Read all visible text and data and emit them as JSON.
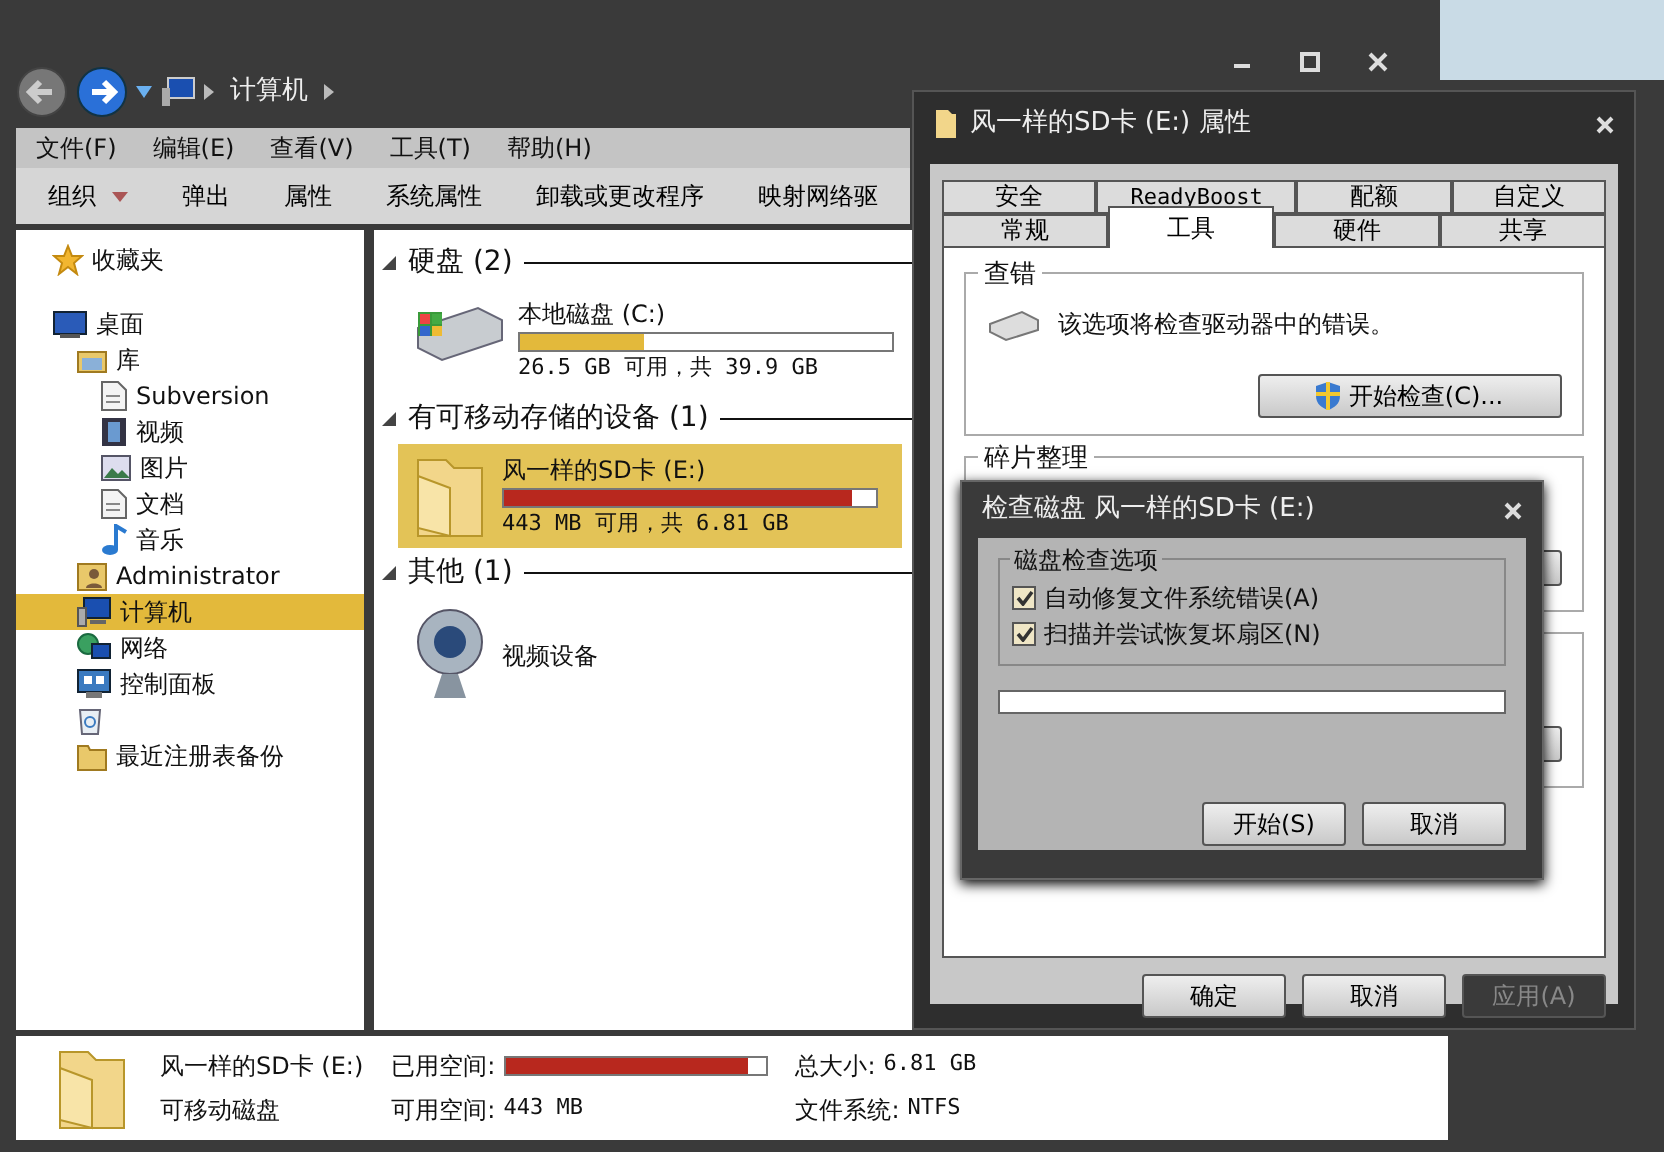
{
  "explorer": {
    "breadcrumb": [
      "计算机"
    ],
    "menu": [
      "文件(F)",
      "编辑(E)",
      "查看(V)",
      "工具(T)",
      "帮助(H)"
    ],
    "toolbar": [
      {
        "label": "组织",
        "dropdown": true
      },
      {
        "label": "弹出",
        "dropdown": false
      },
      {
        "label": "属性",
        "dropdown": false
      },
      {
        "label": "系统属性",
        "dropdown": false
      },
      {
        "label": "卸载或更改程序",
        "dropdown": false
      },
      {
        "label": "映射网络驱",
        "dropdown": false
      }
    ],
    "sidebar": {
      "items": [
        {
          "label": "收藏夹",
          "kind": "star",
          "selected": false
        },
        {
          "label": "桌面",
          "kind": "desktop",
          "selected": false,
          "children": [
            {
              "label": "库",
              "kind": "library",
              "selected": false,
              "children": [
                {
                  "label": "Subversion",
                  "kind": "doc",
                  "selected": false
                },
                {
                  "label": "视频",
                  "kind": "video",
                  "selected": false
                },
                {
                  "label": "图片",
                  "kind": "picture",
                  "selected": false
                },
                {
                  "label": "文档",
                  "kind": "doc",
                  "selected": false
                },
                {
                  "label": "音乐",
                  "kind": "music",
                  "selected": false
                }
              ]
            },
            {
              "label": "Administrator",
              "kind": "user",
              "selected": false
            },
            {
              "label": "计算机",
              "kind": "computer",
              "selected": true
            },
            {
              "label": "网络",
              "kind": "network",
              "selected": false
            },
            {
              "label": "控制面板",
              "kind": "panel",
              "selected": false
            },
            {
              "kind": "recycle",
              "selected": false
            },
            {
              "label": "最近注册表备份",
              "kind": "folder",
              "selected": false
            }
          ]
        }
      ]
    },
    "groups": [
      {
        "title": "硬盘 (2)",
        "items": [
          {
            "kind": "hdd",
            "name": "本地磁盘 (C:)",
            "level": 0.336,
            "free": "26.5 GB 可用，共 39.9 GB",
            "selected": false
          }
        ]
      },
      {
        "title": "有可移动存储的设备 (1)",
        "items": [
          {
            "kind": "sd",
            "name": "风一样的SD卡 (E:)",
            "level": 0.935,
            "free": "443 MB 可用，共 6.81 GB",
            "selected": true
          }
        ]
      },
      {
        "title": "其他 (1)",
        "items": [
          {
            "kind": "webcam",
            "name": "视频设备",
            "selected": false
          }
        ]
      }
    ],
    "status_bar": {
      "name": "风一样的SD卡 (E:)",
      "type": "可移动磁盘",
      "used_label": "已用空间:",
      "level": 0.935,
      "free_label": "可用空间:",
      "free": "443 MB",
      "total_label": "总大小:",
      "total": "6.81 GB",
      "fs_label": "文件系统:",
      "fs": "NTFS"
    }
  },
  "properties_dialog": {
    "title": "风一样的SD卡 (E:) 属性",
    "tabs_back": [
      {
        "label": "安全",
        "selected": false
      },
      {
        "label": "ReadyBoost",
        "selected": false
      },
      {
        "label": "配额",
        "selected": false
      },
      {
        "label": "自定义",
        "selected": false
      }
    ],
    "tabs_front": [
      {
        "label": "常规",
        "selected": false
      },
      {
        "label": "工具",
        "selected": true
      },
      {
        "label": "硬件",
        "selected": false
      },
      {
        "label": "共享",
        "selected": false
      }
    ],
    "error_check": {
      "title": "查错",
      "text": "该选项将检查驱动器中的错误。",
      "button": "开始检查(C)..."
    },
    "defrag": {
      "title": "碎片整理"
    },
    "buttons": [
      {
        "label": "确定",
        "disabled": false
      },
      {
        "label": "取消",
        "disabled": false
      },
      {
        "label": "应用(A)",
        "disabled": true
      }
    ]
  },
  "check_disk_dialog": {
    "title": "检查磁盘 风一样的SD卡 (E:)",
    "group": "磁盘检查选项",
    "options": [
      {
        "label": "自动修复文件系统错误(A)",
        "checked": true
      },
      {
        "label": "扫描并尝试恢复坏扇区(N)",
        "checked": true
      }
    ],
    "progress": {
      "level": 0
    },
    "buttons": [
      {
        "label": "开始(S)",
        "disabled": false
      },
      {
        "label": "取消",
        "disabled": false
      }
    ]
  }
}
